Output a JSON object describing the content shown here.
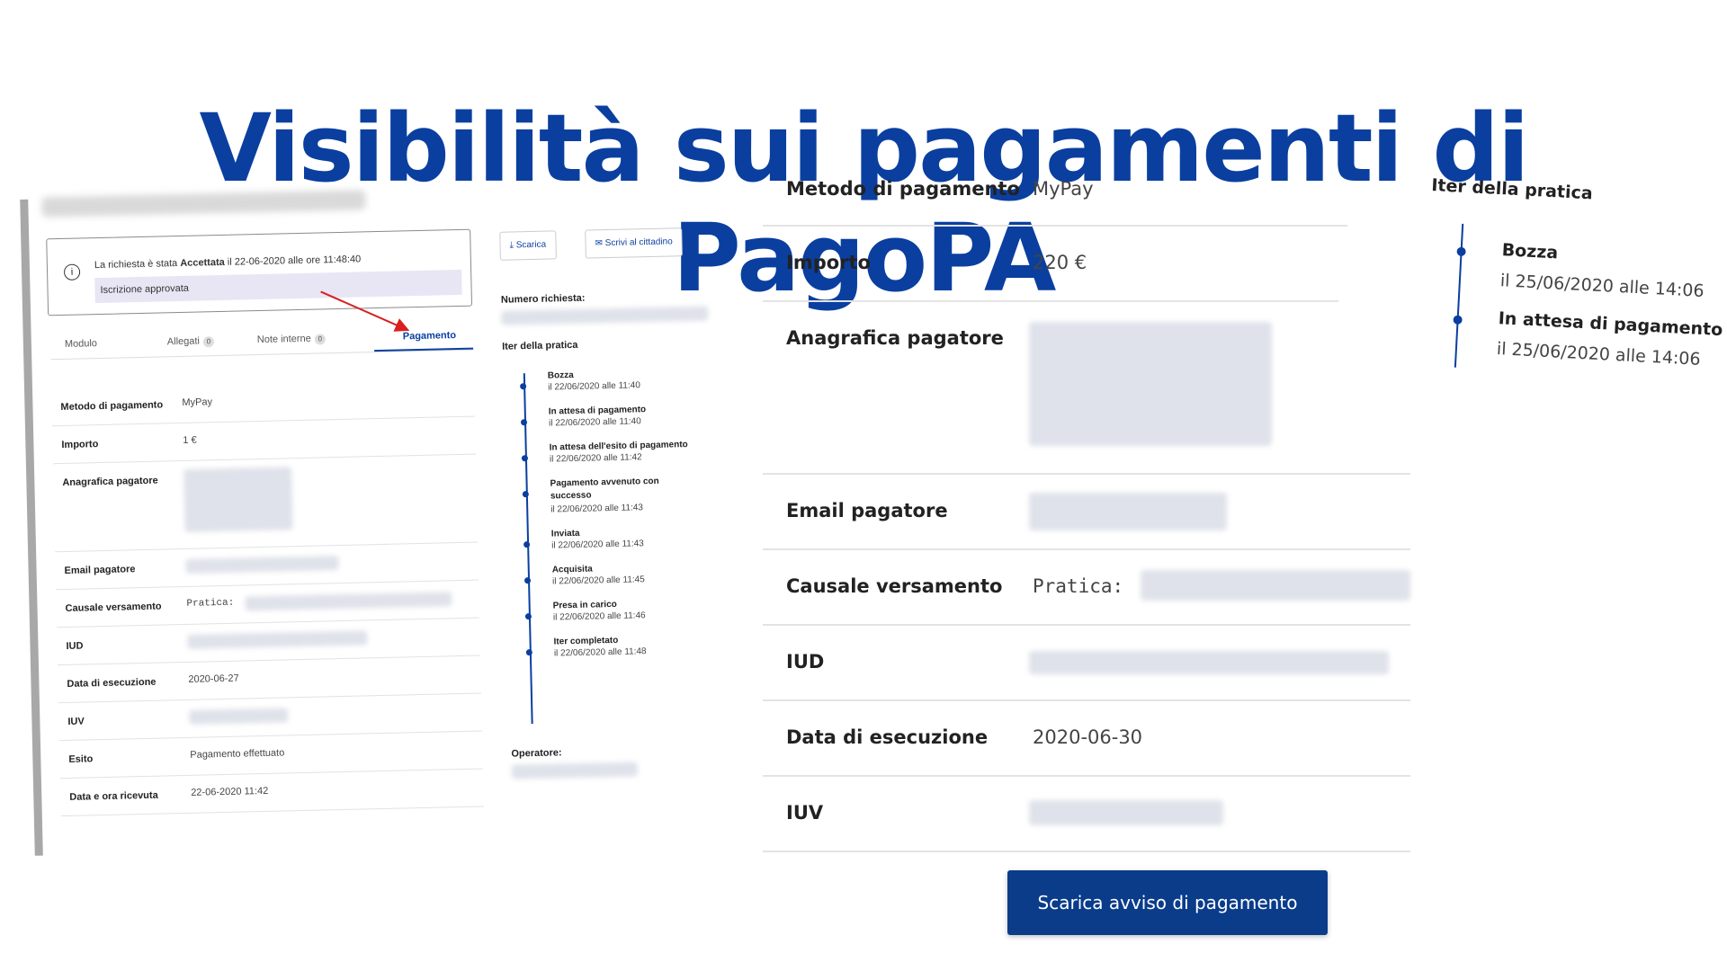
{
  "title": "Visibilità sui pagamenti di PagoPA",
  "screenshot": {
    "notice_prefix": "La richiesta è stata ",
    "notice_status": "Accettata",
    "notice_suffix": " il 22-06-2020 alle ore 11:48:40",
    "notice_detail": "Iscrizione approvata",
    "tabs": [
      {
        "label": "Modulo",
        "count": ""
      },
      {
        "label": "Allegati",
        "count": "0"
      },
      {
        "label": "Note interne",
        "count": "0"
      },
      {
        "label": "Pagamento",
        "count": ""
      }
    ],
    "rows": [
      {
        "key": "Metodo di pagamento",
        "value": "MyPay"
      },
      {
        "key": "Importo",
        "value": "1 €"
      },
      {
        "key": "Anagrafica pagatore",
        "value": ""
      },
      {
        "key": "Email pagatore",
        "value": ""
      },
      {
        "key": "Causale versamento",
        "value": "Pratica:"
      },
      {
        "key": "IUD",
        "value": ""
      },
      {
        "key": "Data di esecuzione",
        "value": "2020-06-27"
      },
      {
        "key": "IUV",
        "value": ""
      },
      {
        "key": "Esito",
        "value": "Pagamento effettuato"
      },
      {
        "key": "Data e ora ricevuta",
        "value": "22-06-2020 11:42"
      }
    ],
    "buttons": {
      "download": "Scarica",
      "write": "Scrivi al cittadino"
    },
    "request_number_label": "Numero richiesta:",
    "timeline_label": "Iter della pratica",
    "timeline": [
      {
        "status": "Bozza",
        "date": "il 22/06/2020 alle 11:40"
      },
      {
        "status": "In attesa di pagamento",
        "date": "il 22/06/2020 alle 11:40"
      },
      {
        "status": "In attesa dell'esito di pagamento",
        "date": "il 22/06/2020 alle 11:42"
      },
      {
        "status": "Pagamento avvenuto con successo",
        "date": "il 22/06/2020 alle 11:43"
      },
      {
        "status": "Inviata",
        "date": "il 22/06/2020 alle 11:43"
      },
      {
        "status": "Acquisita",
        "date": "il 22/06/2020 alle 11:45"
      },
      {
        "status": "Presa in carico",
        "date": "il 22/06/2020 alle 11:46"
      },
      {
        "status": "Iter completato",
        "date": "il 22/06/2020 alle 11:48"
      }
    ],
    "operator_label": "Operatore:"
  },
  "payment": {
    "rows": [
      {
        "key": "Metodo di pagamento",
        "value": "MyPay"
      },
      {
        "key": "Importo",
        "value": "220 €"
      },
      {
        "key": "Anagrafica pagatore",
        "value": ""
      },
      {
        "key": "Email pagatore",
        "value": ""
      },
      {
        "key": "Causale versamento",
        "value": "Pratica:"
      },
      {
        "key": "IUD",
        "value": ""
      },
      {
        "key": "Data di esecuzione",
        "value": "2020-06-30"
      },
      {
        "key": "IUV",
        "value": ""
      }
    ],
    "download_button": "Scarica avviso di pagamento"
  },
  "zoom_timeline": {
    "label": "Iter della pratica",
    "steps": [
      {
        "status": "Bozza",
        "date": "il 25/06/2020 alle 14:06"
      },
      {
        "status": "In attesa di pagamento",
        "date": "il 25/06/2020 alle 14:06"
      }
    ]
  },
  "colors": {
    "brand": "#0a3fa0",
    "button": "#0a3c8a",
    "arrow": "#d9201f"
  }
}
